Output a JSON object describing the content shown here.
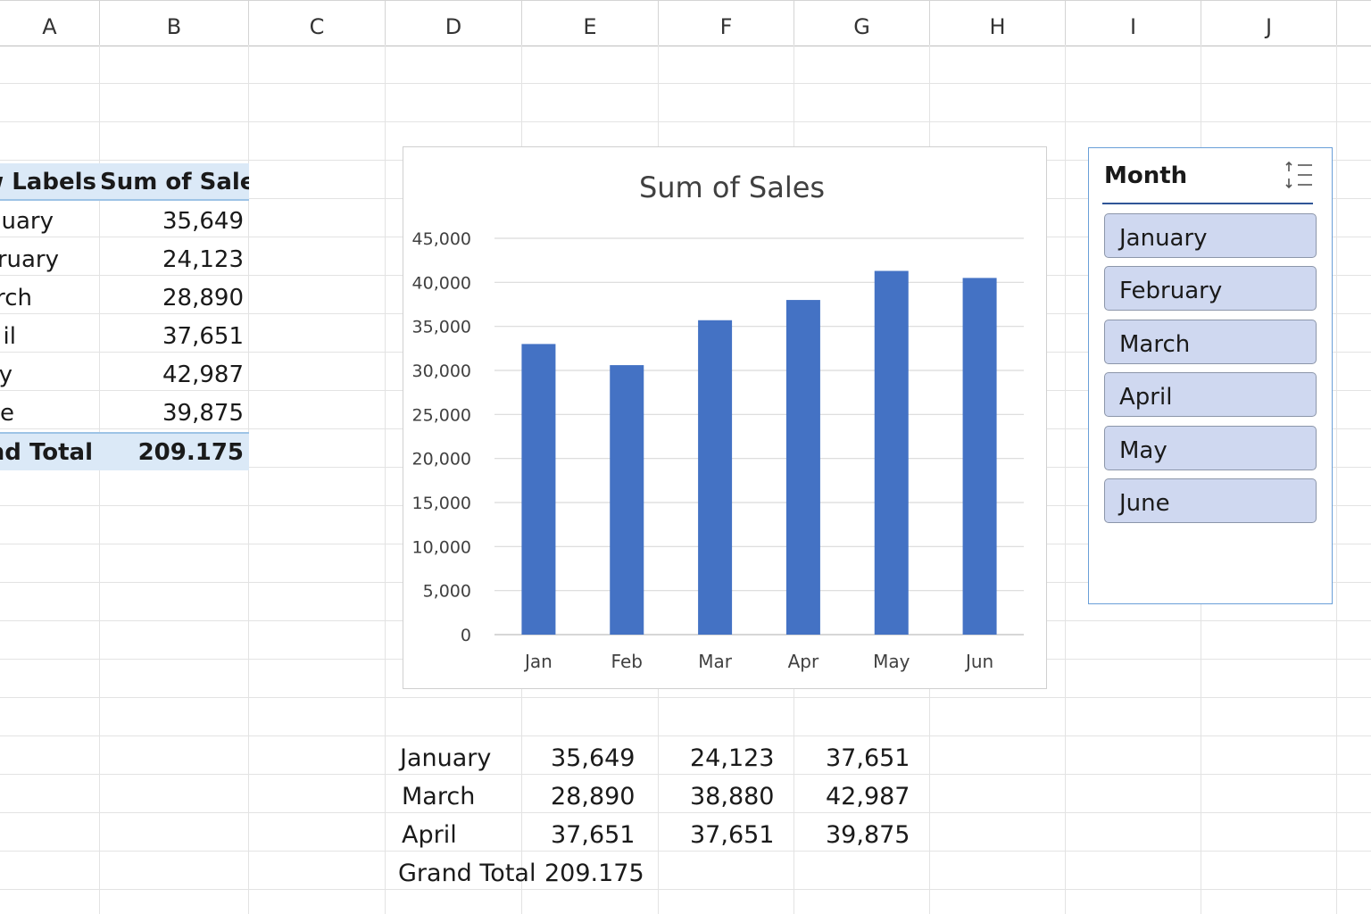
{
  "columns": [
    "A",
    "B",
    "C",
    "D",
    "E",
    "F",
    "G",
    "H",
    "I",
    "J"
  ],
  "pivot": {
    "header": {
      "row_labels": "w Labels",
      "sum_of_sales": "Sum of Sales"
    },
    "rows": [
      {
        "label": "uary",
        "value": "35,649"
      },
      {
        "label": "ruary",
        "value": "24,123"
      },
      {
        "label": "rch",
        "value": "28,890"
      },
      {
        "label": "il",
        "value": "37,651"
      },
      {
        "label": "y",
        "value": "42,987"
      },
      {
        "label": "e",
        "value": "39,875"
      }
    ],
    "total": {
      "label": "nd Total",
      "value": "209.175"
    }
  },
  "chart_data": {
    "type": "bar",
    "title": "Sum of Sales",
    "categories": [
      "Jan",
      "Feb",
      "Mar",
      "Apr",
      "May",
      "Jun"
    ],
    "values": [
      33000,
      30600,
      35700,
      38000,
      41300,
      40500
    ],
    "ylim": [
      0,
      45000
    ],
    "yticks": [
      "0",
      "5,000",
      "10,000",
      "15,000",
      "20,000",
      "25,000",
      "30,000",
      "35,000",
      "40,000",
      "45,000"
    ],
    "bar_color": "#4472c4",
    "grid": true
  },
  "slicer": {
    "title": "Month",
    "icon": "multi-select-icon",
    "items": [
      "January",
      "February",
      "March",
      "April",
      "May",
      "June"
    ]
  },
  "lower_table": {
    "rows": [
      {
        "label": "January",
        "e": "35,649",
        "f": "24,123",
        "g": "37,651"
      },
      {
        "label": "March",
        "e": "28,890",
        "f": "38,880",
        "g": "42,987"
      },
      {
        "label": "April",
        "e": "37,651",
        "f": "37,651",
        "g": "39,875"
      }
    ],
    "total": {
      "label": "Grand Total",
      "value": "209.175"
    }
  }
}
